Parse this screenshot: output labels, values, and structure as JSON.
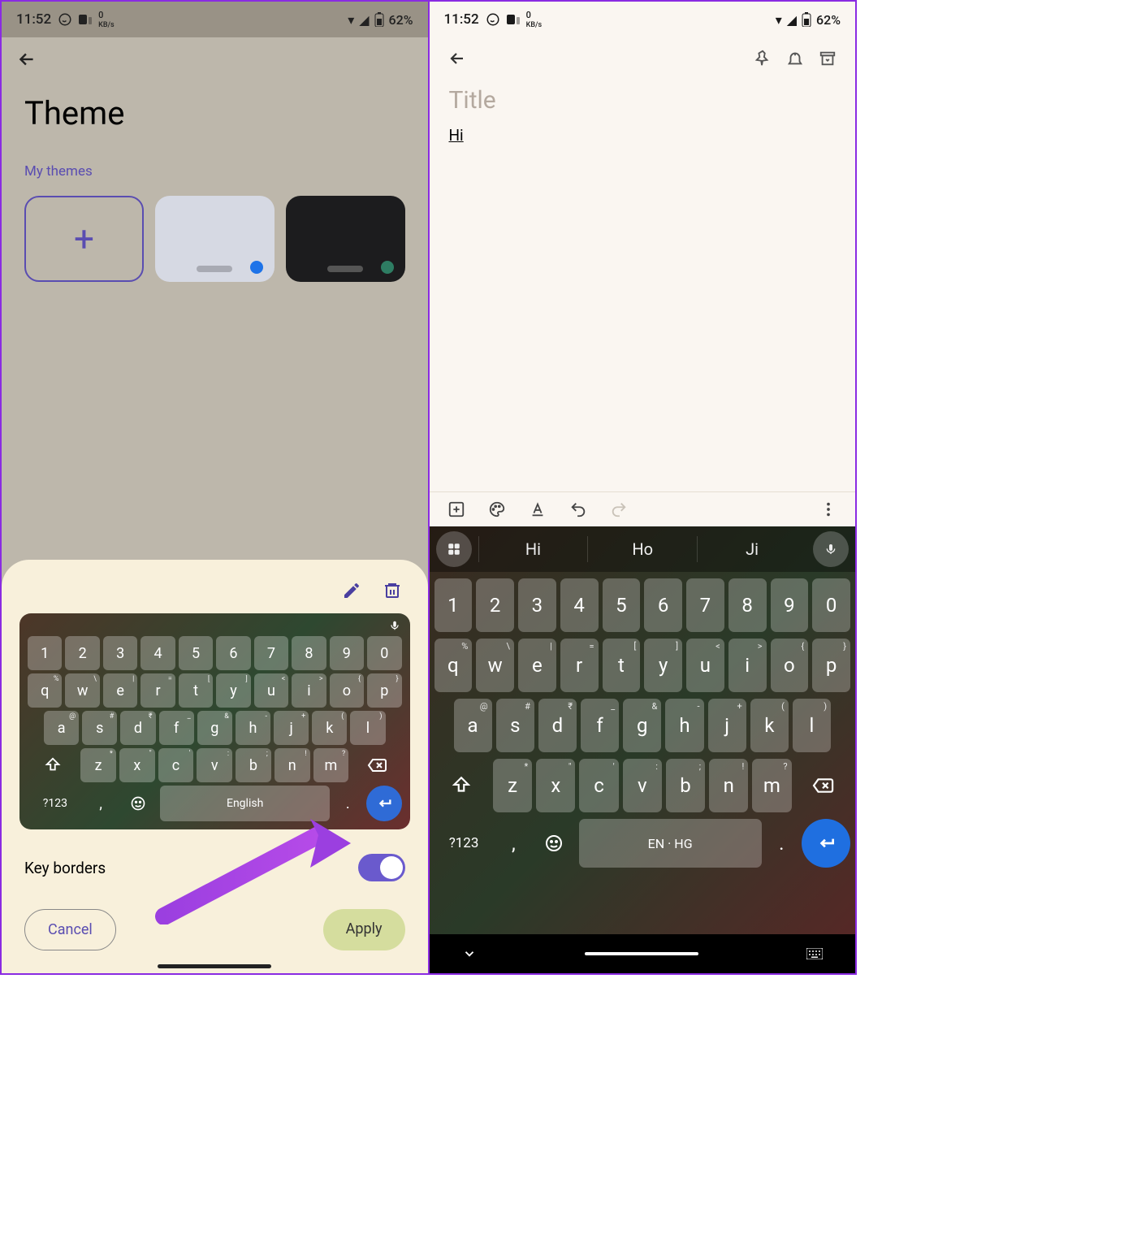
{
  "status": {
    "time": "11:52",
    "net_speed": "0",
    "net_unit": "KB/s",
    "battery": "62%"
  },
  "left": {
    "page_title": "Theme",
    "section": "My themes",
    "sheet": {
      "preview_space_label": "English",
      "symbols_key": "?123",
      "key_borders_label": "Key borders",
      "cancel": "Cancel",
      "apply": "Apply"
    },
    "num_row": [
      "1",
      "2",
      "3",
      "4",
      "5",
      "6",
      "7",
      "8",
      "9",
      "0"
    ],
    "qwerty": [
      {
        "k": "q",
        "s": "%"
      },
      {
        "k": "w",
        "s": "\\"
      },
      {
        "k": "e",
        "s": "|"
      },
      {
        "k": "r",
        "s": "="
      },
      {
        "k": "t",
        "s": "["
      },
      {
        "k": "y",
        "s": "]"
      },
      {
        "k": "u",
        "s": "<"
      },
      {
        "k": "i",
        "s": ">"
      },
      {
        "k": "o",
        "s": "{"
      },
      {
        "k": "p",
        "s": "}"
      }
    ],
    "home": [
      {
        "k": "a",
        "s": "@"
      },
      {
        "k": "s",
        "s": "#"
      },
      {
        "k": "d",
        "s": "₹"
      },
      {
        "k": "f",
        "s": "_"
      },
      {
        "k": "g",
        "s": "&"
      },
      {
        "k": "h",
        "s": "-"
      },
      {
        "k": "j",
        "s": "+"
      },
      {
        "k": "k",
        "s": "("
      },
      {
        "k": "l",
        "s": ")"
      }
    ],
    "bottomr": [
      {
        "k": "z",
        "s": "*"
      },
      {
        "k": "x",
        "s": "\""
      },
      {
        "k": "c",
        "s": "'"
      },
      {
        "k": "v",
        "s": ":"
      },
      {
        "k": "b",
        "s": ";"
      },
      {
        "k": "n",
        "s": "!"
      },
      {
        "k": "m",
        "s": "?"
      }
    ]
  },
  "right": {
    "title_placeholder": "Title",
    "body_text": "Hi",
    "suggestions": [
      "Hi",
      "Ho",
      "Ji"
    ],
    "space_label": "EN · HG",
    "symbols_key": "?123",
    "num_row": [
      "1",
      "2",
      "3",
      "4",
      "5",
      "6",
      "7",
      "8",
      "9",
      "0"
    ],
    "qwerty": [
      {
        "k": "q",
        "s": "%"
      },
      {
        "k": "w",
        "s": "\\"
      },
      {
        "k": "e",
        "s": "|"
      },
      {
        "k": "r",
        "s": "="
      },
      {
        "k": "t",
        "s": "["
      },
      {
        "k": "y",
        "s": "]"
      },
      {
        "k": "u",
        "s": "<"
      },
      {
        "k": "i",
        "s": ">"
      },
      {
        "k": "o",
        "s": "{"
      },
      {
        "k": "p",
        "s": "}"
      }
    ],
    "home": [
      {
        "k": "a",
        "s": "@"
      },
      {
        "k": "s",
        "s": "#"
      },
      {
        "k": "d",
        "s": "₹"
      },
      {
        "k": "f",
        "s": "_"
      },
      {
        "k": "g",
        "s": "&"
      },
      {
        "k": "h",
        "s": "-"
      },
      {
        "k": "j",
        "s": "+"
      },
      {
        "k": "k",
        "s": "("
      },
      {
        "k": "l",
        "s": ")"
      }
    ],
    "bottomr": [
      {
        "k": "z",
        "s": "*"
      },
      {
        "k": "x",
        "s": "\""
      },
      {
        "k": "c",
        "s": "'"
      },
      {
        "k": "v",
        "s": ":"
      },
      {
        "k": "b",
        "s": ";"
      },
      {
        "k": "n",
        "s": "!"
      },
      {
        "k": "m",
        "s": "?"
      }
    ]
  }
}
